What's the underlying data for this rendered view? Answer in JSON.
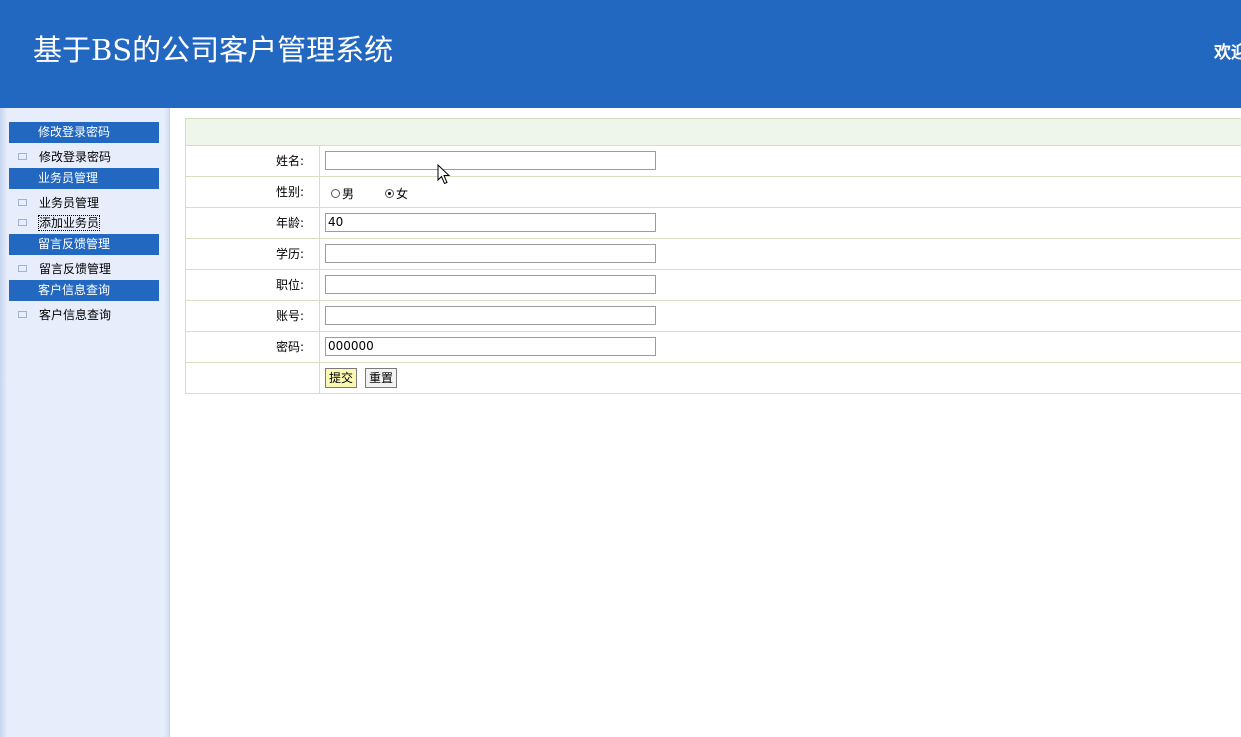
{
  "header": {
    "title": "基于BS的公司客户管理系统",
    "welcome": "欢迎"
  },
  "sidebar": {
    "groups": [
      {
        "title": "修改登录密码",
        "items": [
          "修改登录密码"
        ]
      },
      {
        "title": "业务员管理",
        "items": [
          "业务员管理",
          "添加业务员"
        ]
      },
      {
        "title": "留言反馈管理",
        "items": [
          "留言反馈管理"
        ]
      },
      {
        "title": "客户信息查询",
        "items": [
          "客户信息查询"
        ]
      }
    ]
  },
  "form": {
    "name_label": "姓名:",
    "name_value": "",
    "gender_label": "性别:",
    "gender_options": [
      "男",
      "女"
    ],
    "gender_selected": "女",
    "age_label": "年龄:",
    "age_value": "40",
    "education_label": "学历:",
    "education_value": "",
    "position_label": "职位:",
    "position_value": "",
    "account_label": "账号:",
    "account_value": "",
    "password_label": "密码:",
    "password_value": "000000",
    "submit_label": "提交",
    "reset_label": "重置"
  },
  "colors": {
    "header_bg": "#2368c0",
    "sidebar_bg": "#e7edfb",
    "form_head_bg": "#eef5ea",
    "submit_bg": "#fbf8b4"
  }
}
